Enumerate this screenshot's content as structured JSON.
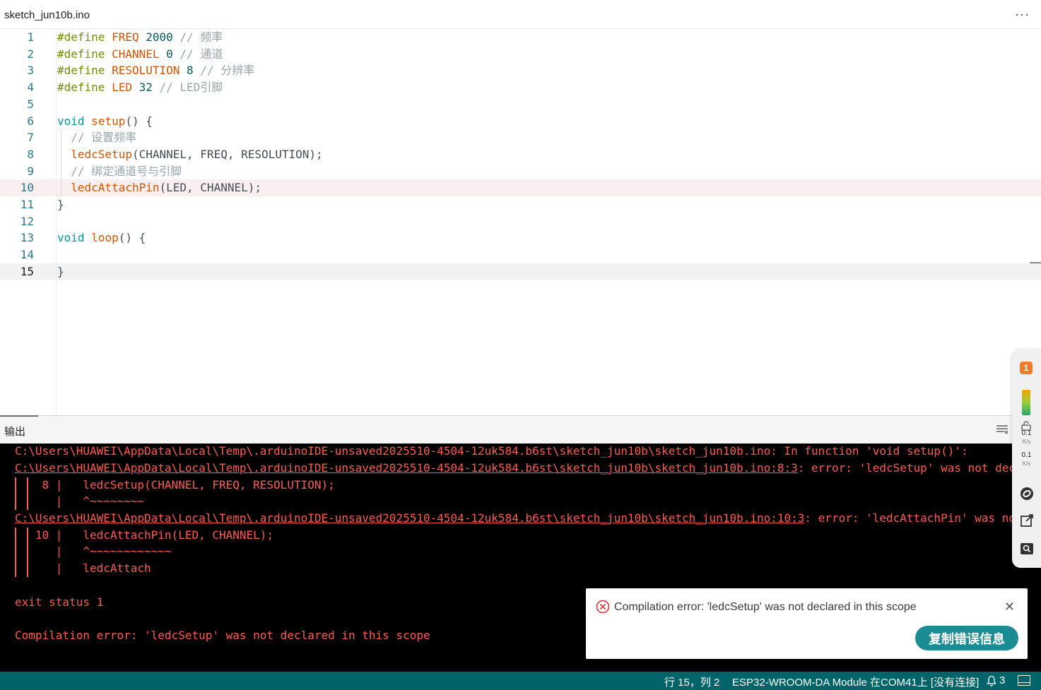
{
  "tab": {
    "label": "sketch_jun10b.ino",
    "more": "···"
  },
  "editor": {
    "lines": [
      {
        "n": "1",
        "parts": [
          {
            "t": "#define ",
            "c": "kw"
          },
          {
            "t": "FREQ",
            "c": "fn"
          },
          {
            "t": " ",
            "c": ""
          },
          {
            "t": "2000",
            "c": "num"
          },
          {
            "t": " // 频率",
            "c": "cm"
          }
        ]
      },
      {
        "n": "2",
        "parts": [
          {
            "t": "#define ",
            "c": "kw"
          },
          {
            "t": "CHANNEL",
            "c": "fn"
          },
          {
            "t": " ",
            "c": ""
          },
          {
            "t": "0",
            "c": "num"
          },
          {
            "t": " // 通道",
            "c": "cm"
          }
        ]
      },
      {
        "n": "3",
        "parts": [
          {
            "t": "#define ",
            "c": "kw"
          },
          {
            "t": "RESOLUTION",
            "c": "fn"
          },
          {
            "t": " ",
            "c": ""
          },
          {
            "t": "8",
            "c": "num"
          },
          {
            "t": " // 分辨率",
            "c": "cm"
          }
        ]
      },
      {
        "n": "4",
        "parts": [
          {
            "t": "#define ",
            "c": "kw"
          },
          {
            "t": "LED",
            "c": "fn"
          },
          {
            "t": " ",
            "c": ""
          },
          {
            "t": "32",
            "c": "num"
          },
          {
            "t": " // LED引脚",
            "c": "cm"
          }
        ]
      },
      {
        "n": "5",
        "parts": []
      },
      {
        "n": "6",
        "parts": [
          {
            "t": "void",
            "c": "kw2"
          },
          {
            "t": " ",
            "c": ""
          },
          {
            "t": "setup",
            "c": "fn"
          },
          {
            "t": "() {",
            "c": ""
          }
        ]
      },
      {
        "n": "7",
        "parts": [
          {
            "t": "  // 设置频率",
            "c": "cm"
          }
        ]
      },
      {
        "n": "8",
        "parts": [
          {
            "t": "  ",
            "c": ""
          },
          {
            "t": "ledcSetup",
            "c": "fn"
          },
          {
            "t": "(CHANNEL, FREQ, RESOLUTION);",
            "c": ""
          }
        ]
      },
      {
        "n": "9",
        "parts": [
          {
            "t": "  // 绑定通道号与引脚",
            "c": "cm"
          }
        ]
      },
      {
        "n": "10",
        "parts": [
          {
            "t": "  ",
            "c": ""
          },
          {
            "t": "ledcAttachPin",
            "c": "fn"
          },
          {
            "t": "(LED, CHANNEL);",
            "c": ""
          }
        ],
        "error": true
      },
      {
        "n": "11",
        "parts": [
          {
            "t": "}",
            "c": ""
          }
        ]
      },
      {
        "n": "12",
        "parts": []
      },
      {
        "n": "13",
        "parts": [
          {
            "t": "void",
            "c": "kw2"
          },
          {
            "t": " ",
            "c": ""
          },
          {
            "t": "loop",
            "c": "fn"
          },
          {
            "t": "() {",
            "c": ""
          }
        ]
      },
      {
        "n": "14",
        "parts": []
      },
      {
        "n": "15",
        "parts": [
          {
            "t": "}",
            "c": ""
          }
        ],
        "current": true
      }
    ]
  },
  "output": {
    "title": "输出",
    "lines": [
      {
        "text": "C:\\Users\\HUAWEI\\AppData\\Local\\Temp\\.arduinoIDE-unsaved2025510-4504-12uk584.b6st\\sketch_jun10b\\sketch_jun10b.ino: In function 'void setup()':",
        "link": ""
      },
      {
        "text": ": error: 'ledcSetup' was not declared in this scope",
        "link": "C:\\Users\\HUAWEI\\AppData\\Local\\Temp\\.arduinoIDE-unsaved2025510-4504-12uk584.b6st\\sketch_jun10b\\sketch_jun10b.ino:8:3"
      },
      {
        "text": "    8 |   ledcSetup(CHANNEL, FREQ, RESOLUTION);",
        "link": ""
      },
      {
        "text": "      |   ^~~~~~~~~",
        "link": ""
      },
      {
        "text": ": error: 'ledcAttachPin' was not declared in this scope",
        "link": "C:\\Users\\HUAWEI\\AppData\\Local\\Temp\\.arduinoIDE-unsaved2025510-4504-12uk584.b6st\\sketch_jun10b\\sketch_jun10b.ino:10:3"
      },
      {
        "text": "   10 |   ledcAttachPin(LED, CHANNEL);",
        "link": ""
      },
      {
        "text": "      |   ^~~~~~~~~~~~~",
        "link": ""
      },
      {
        "text": "      |   ledcAttach",
        "link": ""
      },
      {
        "text": "",
        "link": ""
      },
      {
        "text": "exit status 1",
        "link": ""
      },
      {
        "text": "",
        "link": ""
      },
      {
        "text": "Compilation error: 'ledcSetup' was not declared in this scope",
        "link": ""
      }
    ]
  },
  "notification": {
    "message": "Compilation error: 'ledcSetup' was not declared in this scope",
    "close": "✕",
    "button": "复制错误信息"
  },
  "widget": {
    "badge": "1",
    "speed_up": "0.1",
    "speed_up_unit": "K/s",
    "speed_down": "0.1",
    "speed_down_unit": "K/s"
  },
  "statusbar": {
    "position": "行 15，列 2",
    "board": "ESP32-WROOM-DA Module 在COM41上 [没有连接]",
    "notifications": "3"
  },
  "colors": {
    "statusbar": "#006468",
    "error_text": "#ff5a4e",
    "button": "#1b8c94"
  }
}
